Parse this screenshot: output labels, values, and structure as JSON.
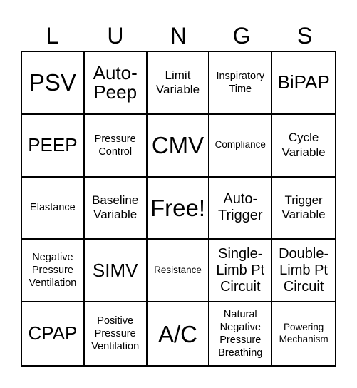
{
  "header": {
    "letters": [
      "L",
      "U",
      "N",
      "G",
      "S"
    ]
  },
  "board": {
    "cells": [
      {
        "text": "PSV",
        "size": "s-xl"
      },
      {
        "text": "Auto-\nPeep",
        "size": "s-lg"
      },
      {
        "text": "Limit\nVariable",
        "size": "s-sm"
      },
      {
        "text": "Inspiratory\nTime",
        "size": "s-xs"
      },
      {
        "text": "BiPAP",
        "size": "s-lg"
      },
      {
        "text": "PEEP",
        "size": "s-lg"
      },
      {
        "text": "Pressure\nControl",
        "size": "s-xs"
      },
      {
        "text": "CMV",
        "size": "s-xl"
      },
      {
        "text": "Compliance",
        "size": "s-xxs"
      },
      {
        "text": "Cycle\nVariable",
        "size": "s-sm"
      },
      {
        "text": "Elastance",
        "size": "s-xs"
      },
      {
        "text": "Baseline\nVariable",
        "size": "s-sm"
      },
      {
        "text": "Free!",
        "size": "s-xl"
      },
      {
        "text": "Auto-\nTrigger",
        "size": "s-md"
      },
      {
        "text": "Trigger\nVariable",
        "size": "s-sm"
      },
      {
        "text": "Negative\nPressure\nVentilation",
        "size": "s-xs"
      },
      {
        "text": "SIMV",
        "size": "s-lg"
      },
      {
        "text": "Resistance",
        "size": "s-xxs"
      },
      {
        "text": "Single-\nLimb Pt\nCircuit",
        "size": "s-md"
      },
      {
        "text": "Double-\nLimb Pt\nCircuit",
        "size": "s-md"
      },
      {
        "text": "CPAP",
        "size": "s-lg"
      },
      {
        "text": "Positive\nPressure\nVentilation",
        "size": "s-xs"
      },
      {
        "text": "A/C",
        "size": "s-xl"
      },
      {
        "text": "Natural\nNegative\nPressure\nBreathing",
        "size": "s-xs"
      },
      {
        "text": "Powering\nMechanism",
        "size": "s-xxs"
      }
    ]
  }
}
